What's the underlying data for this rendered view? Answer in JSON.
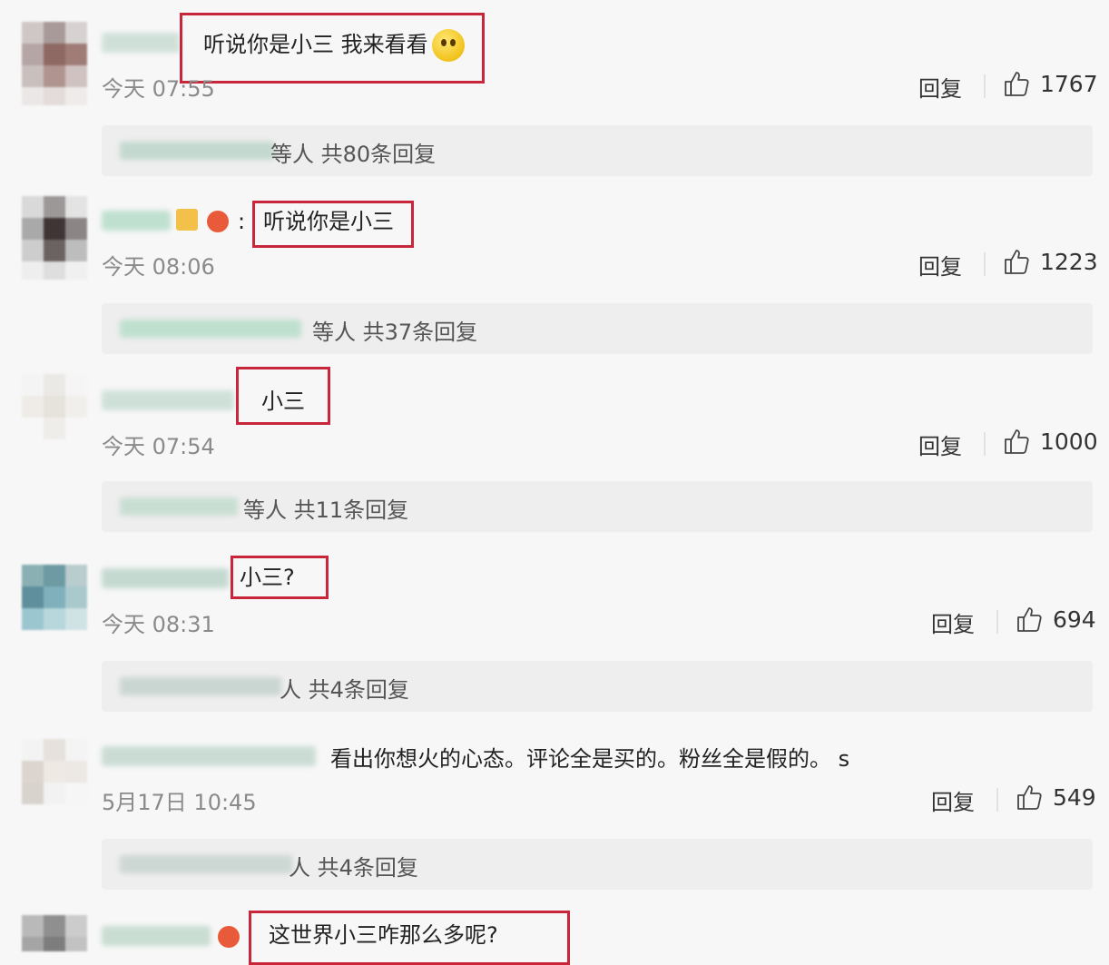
{
  "comments": [
    {
      "text": "听说你是小三 我来看看",
      "time": "今天 07:55",
      "reply": "回复",
      "likes": "1767",
      "sub_suffix": "等人",
      "sub_count": "共80条回复"
    },
    {
      "text": "听说你是小三",
      "time": "今天 08:06",
      "reply": "回复",
      "likes": "1223",
      "sub_suffix": "等人",
      "sub_count": "共37条回复"
    },
    {
      "text": "小三",
      "time": "今天 07:54",
      "reply": "回复",
      "likes": "1000",
      "sub_suffix": "等人",
      "sub_count": "共11条回复"
    },
    {
      "text": "小三?",
      "time": "今天 08:31",
      "reply": "回复",
      "likes": "694",
      "sub_suffix": "人",
      "sub_count": "共4条回复"
    },
    {
      "text": "看出你想火的心态。评论全是买的。粉丝全是假的。 s",
      "time": "5月17日 10:45",
      "reply": "回复",
      "likes": "549",
      "sub_suffix": "人",
      "sub_count": "共4条回复"
    },
    {
      "text": "这世界小三咋那么多呢?"
    }
  ],
  "colors": {
    "highlight_box": "#c8263a",
    "time": "#8a8a8a",
    "sub_bg": "#eeeeee"
  }
}
